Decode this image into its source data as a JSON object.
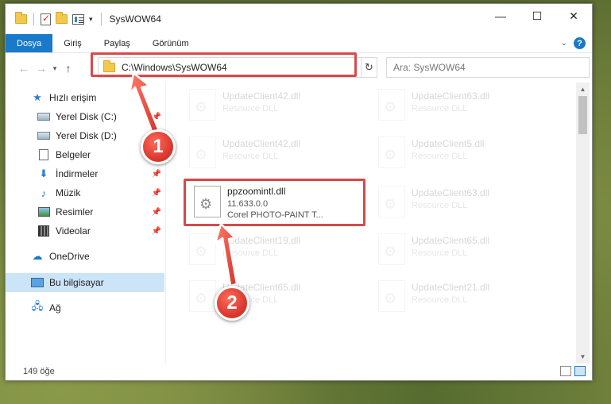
{
  "window": {
    "title": "SysWOW64",
    "minimize": "—",
    "maximize": "☐",
    "close": "✕"
  },
  "ribbon": {
    "tabs": [
      {
        "label": "Dosya",
        "active": true
      },
      {
        "label": "Giriş"
      },
      {
        "label": "Paylaş"
      },
      {
        "label": "Görünüm"
      }
    ],
    "help": "?"
  },
  "nav": {
    "back": "←",
    "forward": "→",
    "recent": "▾",
    "up": "↑",
    "address_path": "C:\\Windows\\SysWOW64",
    "refresh": "↻",
    "search_placeholder": "Ara: SysWOW64"
  },
  "sidebar": {
    "items": [
      {
        "label": "Hızlı erişim",
        "icon": "star-icon"
      },
      {
        "label": "Yerel Disk (C:)",
        "icon": "drive-icon",
        "pinned": true
      },
      {
        "label": "Yerel Disk (D:)",
        "icon": "drive-icon"
      },
      {
        "label": "Belgeler",
        "icon": "documents-icon"
      },
      {
        "label": "İndirmeler",
        "icon": "download-icon",
        "pinned": true
      },
      {
        "label": "Müzik",
        "icon": "music-icon",
        "pinned": true
      },
      {
        "label": "Resimler",
        "icon": "pictures-icon",
        "pinned": true
      },
      {
        "label": "Videolar",
        "icon": "videos-icon",
        "pinned": true
      },
      {
        "label": "OneDrive",
        "icon": "cloud-icon"
      },
      {
        "label": "Bu bilgisayar",
        "icon": "computer-icon",
        "selected": true
      },
      {
        "label": "Ağ",
        "icon": "network-icon"
      }
    ]
  },
  "files": {
    "left": [
      {
        "name": "UpdateClient42.dll",
        "sub": "Resource DLL"
      },
      {
        "name": "UpdateClient42.dll",
        "sub": "Resource DLL"
      },
      {
        "name": "ppzoomintl.dll",
        "sub": "11.633.0.0",
        "sub2": "Corel PHOTO-PAINT T...",
        "focus": true
      },
      {
        "name": "UpdateClient19.dll",
        "sub": "Resource DLL"
      },
      {
        "name": "UpdateClient65.dll",
        "sub": "Resource DLL"
      }
    ],
    "right": [
      {
        "name": "UpdateClient63.dll",
        "sub": "Resource DLL"
      },
      {
        "name": "UpdateClient5.dll",
        "sub": "Resource DLL"
      },
      {
        "name": "UpdateClient63.dll",
        "sub": "Resource DLL"
      },
      {
        "name": "UpdateClient65.dll",
        "sub": "Resource DLL"
      },
      {
        "name": "UpdateClient21.dll",
        "sub": "Resource DLL"
      }
    ]
  },
  "status": {
    "count": "149 öğe"
  },
  "annotations": {
    "step1": "1",
    "step2": "2",
    "color": "#d64a4a"
  }
}
